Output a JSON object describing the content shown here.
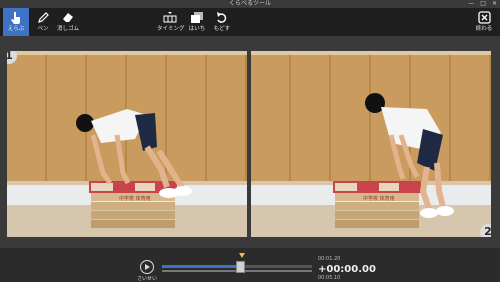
{
  "window": {
    "title": "くらべるツール",
    "controls": [
      "—",
      "□",
      "✕"
    ]
  },
  "toolbar": {
    "tools": [
      {
        "label": "えらぶ",
        "icon": "hand-pointer-icon",
        "active": true
      },
      {
        "label": "ペン",
        "icon": "pen-icon",
        "active": false
      },
      {
        "label": "消しゴム",
        "icon": "eraser-icon",
        "active": false
      },
      {
        "label": "タイミング",
        "icon": "timing-icon",
        "active": false
      },
      {
        "label": "はいち",
        "icon": "layout-icon",
        "active": false
      },
      {
        "label": "もどす",
        "icon": "undo-icon",
        "active": false
      },
      {
        "label": "終わる",
        "icon": "close-box-icon",
        "active": false
      }
    ]
  },
  "panels": [
    {
      "badge": "1",
      "box_text": "中学校 体育用"
    },
    {
      "badge": "2",
      "box_text": "中学校 体育用"
    }
  ],
  "playback": {
    "play_label": "さいせい",
    "time_start": "00:01.20",
    "time_current": "+00:00.00",
    "time_end": "00:05.10",
    "position": 0.52
  },
  "colors": {
    "accent": "#3d72c4",
    "marker": "#f2b84b",
    "toolbar_bg": "#1f1f1f"
  }
}
